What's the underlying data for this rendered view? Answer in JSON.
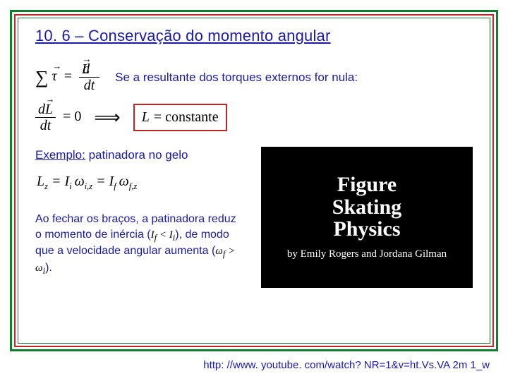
{
  "title": "10. 6 – Conservação do momento angular",
  "statement": "Se a resultante dos torques externos for nula:",
  "eq_sum_tau": "∑",
  "eq_tau": "τ",
  "eq_eqsign": "=",
  "frac_num": "dL",
  "frac_den": "dt",
  "eq2_left_num": "dL",
  "eq2_left_den": "dt",
  "eq2_zero": "= 0",
  "arrow": "⟹",
  "box_L": "L",
  "box_eq": "= constante",
  "example_pre": "Exemplo:",
  "example_rest": " patinadora no gelo",
  "lz_html": "L<sub>z</sub> = I<sub>i</sub> ω<sub>i,z</sub> = I<sub>f</sub> ω<sub>f,z</sub>",
  "para1": "Ao fechar os braços, a patinadora reduz o momento de inércia (",
  "para_math1": "Iᶠ < Iᵢ",
  "para2": "), de modo que a velocidade angular aumenta (",
  "para_math2": "ωᶠ > ωᵢ",
  "para3": ").",
  "video_title_l1": "Figure",
  "video_title_l2": "Skating",
  "video_title_l3": "Physics",
  "video_credit": "by Emily Rogers and Jordana Gilman",
  "footer_url": "http: //www. youtube. com/watch? NR=1&v=ht.Vs.VA 2m 1_w"
}
